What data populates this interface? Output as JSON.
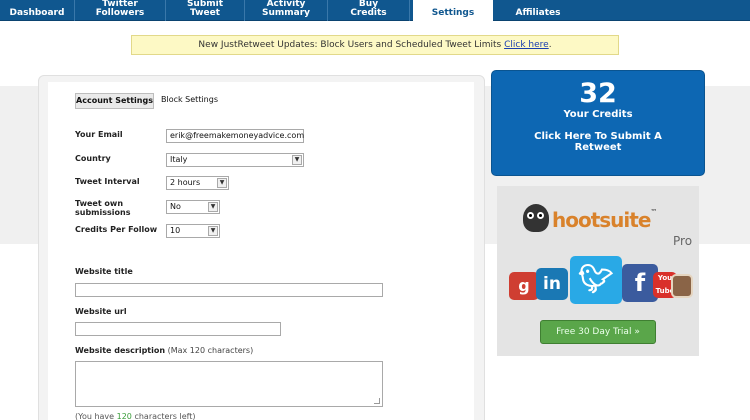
{
  "nav": {
    "tabs": [
      {
        "line1": "Dashboard",
        "line2": ""
      },
      {
        "line1": "Twitter",
        "line2": "Followers"
      },
      {
        "line1": "Submit",
        "line2": "Tweet"
      },
      {
        "line1": "Activity",
        "line2": "Summary"
      },
      {
        "line1": "Buy",
        "line2": "Credits"
      },
      {
        "line1": "Settings",
        "line2": ""
      },
      {
        "line1": "Affiliates",
        "line2": ""
      }
    ],
    "active_tab": "Settings"
  },
  "announcement": {
    "text": "New JustRetweet Updates: Block Users and Scheduled Tweet Limits ",
    "link": "Click here",
    "suffix": "."
  },
  "settings_tabs": {
    "account": "Account Settings",
    "block": "Block Settings"
  },
  "form": {
    "email_label": "Your Email",
    "email_value": "erik@freemakemoneyadvice.com",
    "country_label": "Country",
    "country_value": "Italy",
    "interval_label": "Tweet Interval",
    "interval_value": "2 hours",
    "own_label_1": "Tweet own",
    "own_label_2": "submissions",
    "own_value": "No",
    "cpf_label": "Credits Per Follow",
    "cpf_value": "10",
    "site_title_label": "Website title",
    "site_title_value": "",
    "site_url_label": "Website url",
    "site_url_value": "",
    "site_desc_label": "Website description",
    "site_desc_hint": " (Max 120 characters)",
    "counter_pre": "(You have ",
    "counter_num": "120",
    "counter_post": " characters left)"
  },
  "credits": {
    "count": "32",
    "label": "Your Credits",
    "cta_1": "Click Here To Submit A",
    "cta_2": "Retweet",
    "color": "#0d67b3"
  },
  "ad": {
    "brand": "hootsuite",
    "tm": "™",
    "tier": "Pro",
    "icons": [
      "google-plus-icon",
      "linkedin-icon",
      "twitter-icon",
      "facebook-icon",
      "youtube-icon",
      "instagram-icon"
    ],
    "button": "Free 30 Day Trial »"
  },
  "colors": {
    "nav": "#10578f",
    "accent_green": "#5aa64a",
    "brand_orange": "#d9822b"
  }
}
